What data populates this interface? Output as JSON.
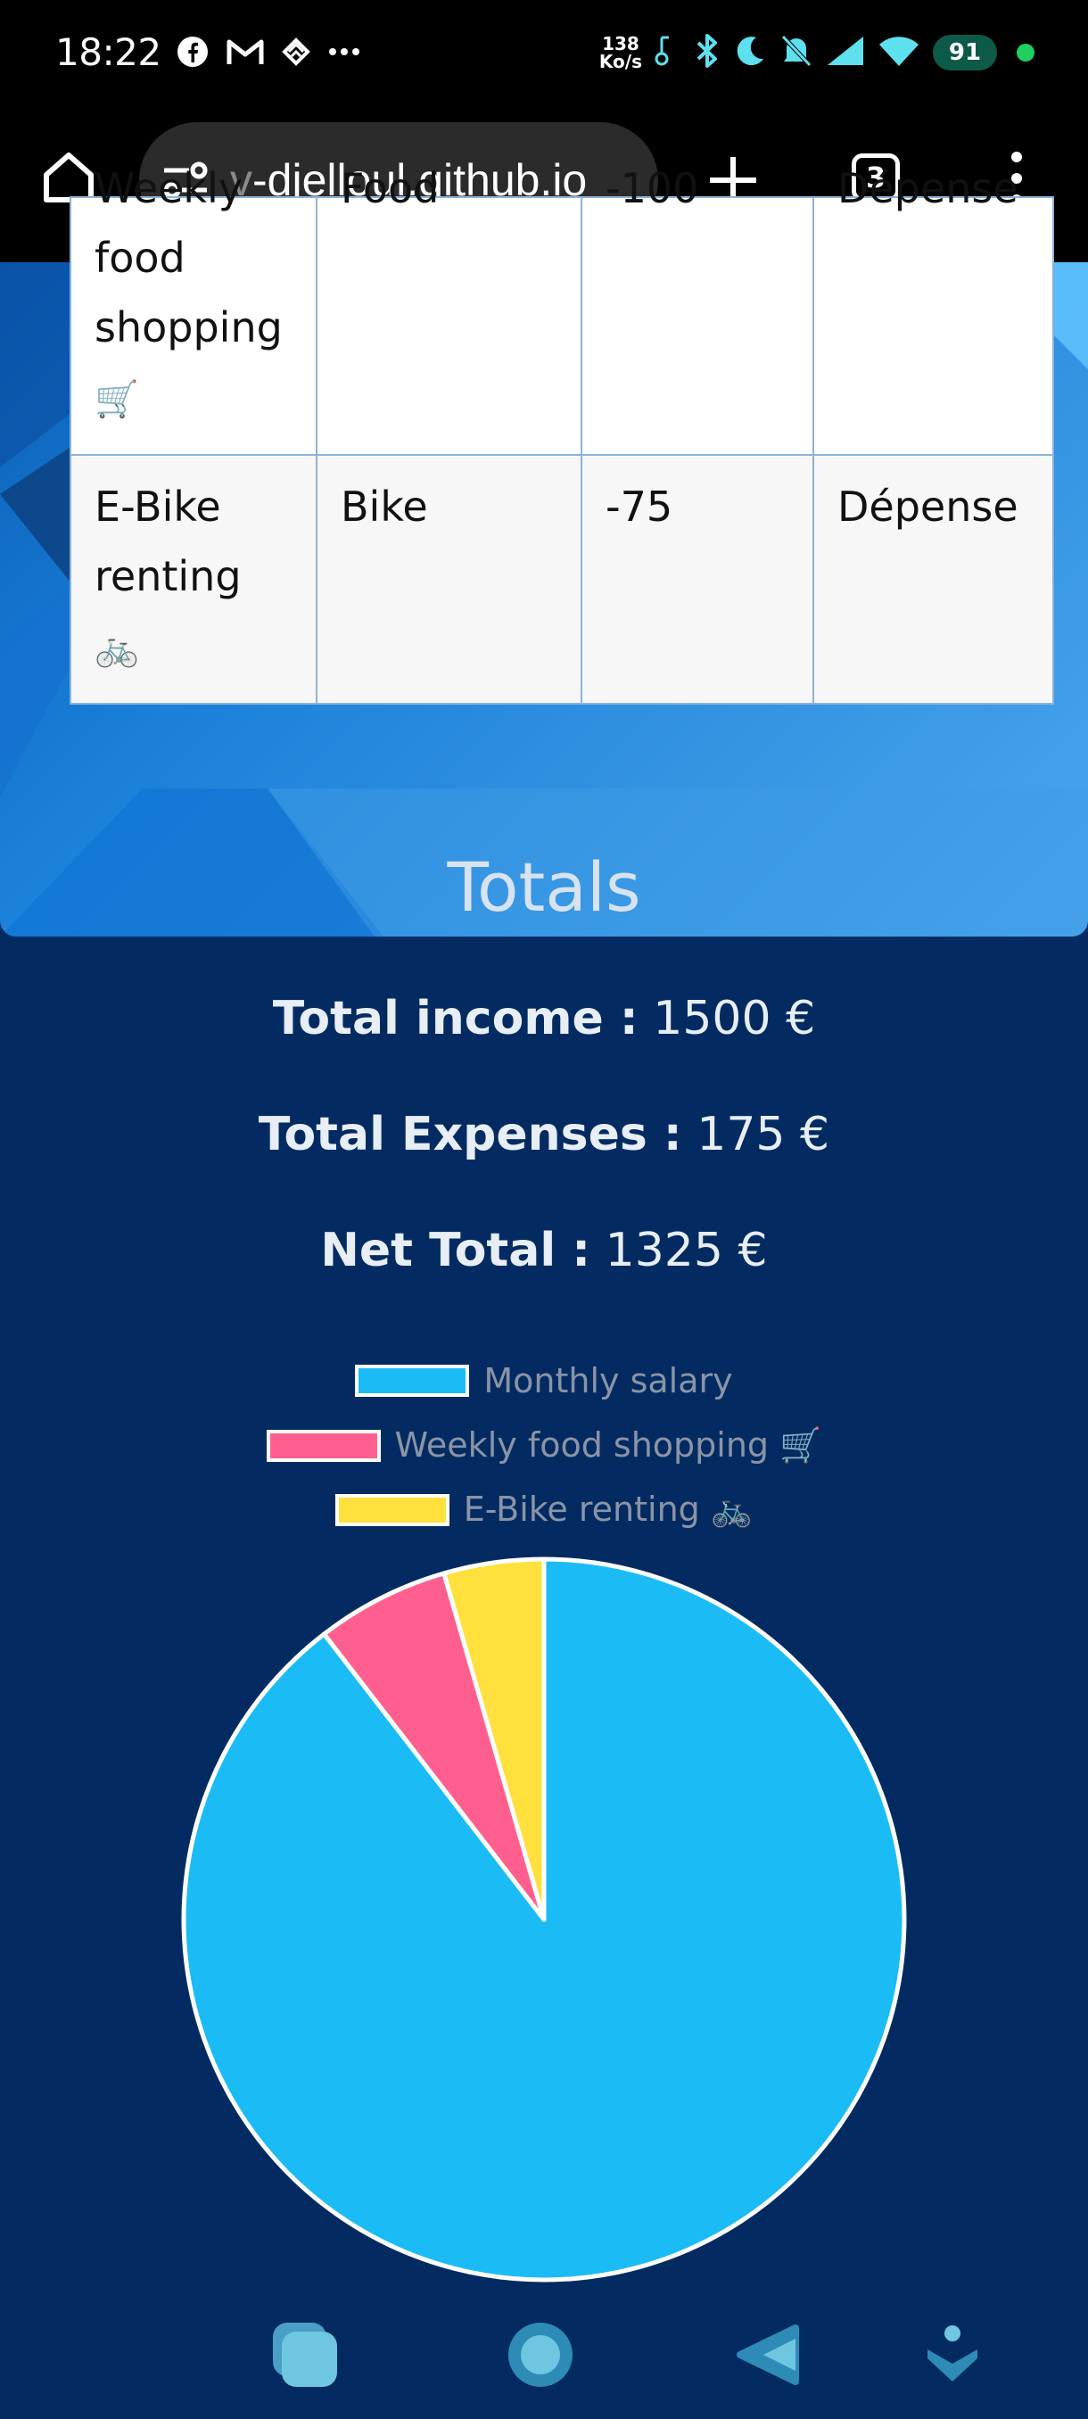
{
  "status_bar": {
    "time": "18:22",
    "net_speed_value": "138",
    "net_speed_unit": "Ko/s",
    "battery": "91",
    "icons": [
      "facebook-icon",
      "gmail-icon",
      "app-icon",
      "more-icon",
      "bluetooth-icon",
      "moon-icon",
      "mute-icon",
      "signal-icon",
      "wifi-icon"
    ]
  },
  "browser": {
    "url_fade": "v",
    "url_rest": "-djelloul.github.io",
    "tab_count": "3"
  },
  "table": {
    "rows": [
      {
        "desc": "Weekly food shopping",
        "emoji": "🛒",
        "category": "Food",
        "amount": "-100",
        "type": "Dépense"
      },
      {
        "desc": "E-Bike renting",
        "emoji": "🚲",
        "category": "Bike",
        "amount": "-75",
        "type": "Dépense"
      }
    ]
  },
  "totals": {
    "title": "Totals",
    "income_label": "Total income :",
    "income_value": "1500 €",
    "expenses_label": "Total Expenses :",
    "expenses_value": "175 €",
    "net_label": "Net Total :",
    "net_value": "1325 €"
  },
  "chart_data": {
    "type": "pie",
    "categories": [
      "Monthly salary",
      "Weekly food shopping 🛒",
      "E-Bike renting 🚲"
    ],
    "values": [
      1500,
      100,
      75
    ],
    "colors": [
      "#1bbcf5",
      "#ff5f8f",
      "#ffe03d"
    ],
    "legend_position": "top"
  }
}
